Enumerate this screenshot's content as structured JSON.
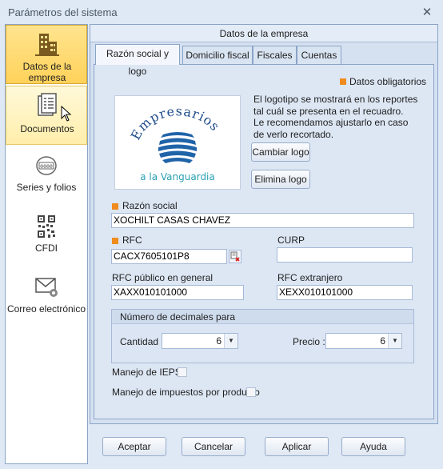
{
  "window": {
    "title": "Parámetros del sistema",
    "close_glyph": "✕"
  },
  "sidebar": {
    "items": [
      {
        "label_line1": "Datos de la",
        "label_line2": "empresa",
        "icon": "building-icon"
      },
      {
        "label": "Documentos",
        "icon": "documents-icon"
      },
      {
        "label": "Series y folios",
        "icon": "series-counter-icon"
      },
      {
        "label": "CFDI",
        "icon": "qr-code-icon"
      },
      {
        "label": "Correo electrónico",
        "icon": "email-gear-icon"
      }
    ]
  },
  "main": {
    "group_title": "Datos de la empresa",
    "tabs": [
      "Razón social y logo",
      "Domicilio fiscal",
      "Fiscales",
      "Cuentas"
    ],
    "required_legend": "Datos obligatorios",
    "logo_note": [
      "El logotipo se mostrará en los reportes",
      "tal cuál se presenta en el recuadro.",
      "Le recomendamos ajustarlo en caso",
      "de verlo recortado."
    ],
    "logo": {
      "line1": "Empresarios",
      "line2": "a la Vanguardia"
    },
    "change_logo_label": "Cambiar logo",
    "remove_logo_label": "Elimina logo",
    "razon_social": {
      "label": "Razón social",
      "value": "XOCHILT CASAS CHAVEZ"
    },
    "rfc": {
      "label": "RFC",
      "value": "CACX7605101P8"
    },
    "curp": {
      "label": "CURP",
      "value": ""
    },
    "rfc_publico": {
      "label": "RFC público en general",
      "value": "XAXX010101000"
    },
    "rfc_extranjero": {
      "label": "RFC extranjero",
      "value": "XEXX010101000"
    },
    "decimals": {
      "title": "Número de decimales para",
      "cantidad_label": "Cantidad :",
      "cantidad_value": "6",
      "precio_label": "Precio :",
      "precio_value": "6"
    },
    "ieps_label": "Manejo de IEPS",
    "impuestos_label": "Manejo de impuestos por producto"
  },
  "footer": {
    "accept": "Aceptar",
    "cancel": "Cancelar",
    "apply": "Aplicar",
    "help": "Ayuda"
  },
  "colors": {
    "required": "#f08c1e",
    "active_nav": "#ffd25a",
    "logo_blue": "#1f63a8",
    "logo_teal": "#2aa0b4"
  }
}
